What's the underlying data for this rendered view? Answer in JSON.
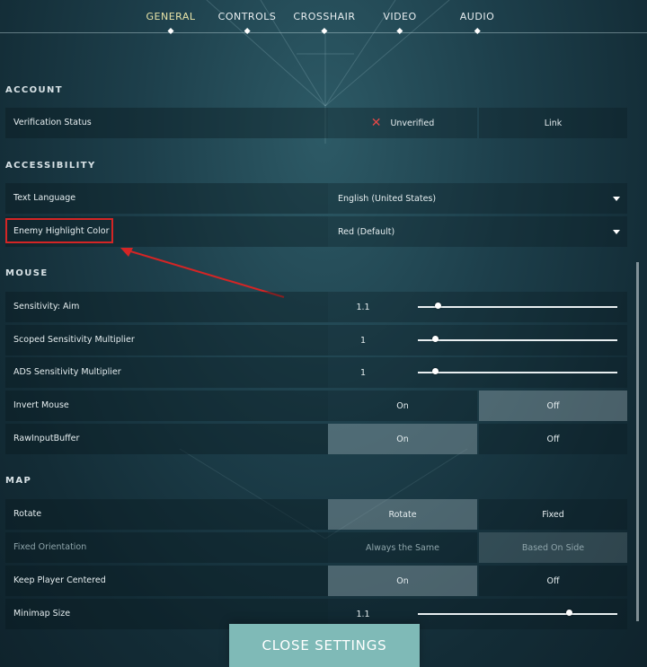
{
  "nav": {
    "tabs": [
      {
        "label": "GENERAL",
        "active": true
      },
      {
        "label": "CONTROLS",
        "active": false
      },
      {
        "label": "CROSSHAIR",
        "active": false
      },
      {
        "label": "VIDEO",
        "active": false
      },
      {
        "label": "AUDIO",
        "active": false
      }
    ]
  },
  "account": {
    "header": "ACCOUNT",
    "verification_label": "Verification Status",
    "status_text": "Unverified",
    "status_icon": "x-icon",
    "link_label": "Link"
  },
  "accessibility": {
    "header": "ACCESSIBILITY",
    "text_language_label": "Text Language",
    "text_language_value": "English (United States)",
    "enemy_highlight_label": "Enemy Highlight Color",
    "enemy_highlight_value": "Red (Default)"
  },
  "mouse": {
    "header": "MOUSE",
    "sensitivity_aim_label": "Sensitivity: Aim",
    "sensitivity_aim_value": "1.1",
    "sensitivity_aim_fraction": 0.1,
    "scoped_label": "Scoped Sensitivity Multiplier",
    "scoped_value": "1",
    "scoped_fraction": 0.09,
    "ads_label": "ADS Sensitivity Multiplier",
    "ads_value": "1",
    "ads_fraction": 0.09,
    "invert_label": "Invert Mouse",
    "invert_on": "On",
    "invert_off": "Off",
    "invert_selected": "off",
    "rawinput_label": "RawInputBuffer",
    "rawinput_on": "On",
    "rawinput_off": "Off",
    "rawinput_selected": "on"
  },
  "map": {
    "header": "MAP",
    "rotate_label": "Rotate",
    "rotate_option_a": "Rotate",
    "rotate_option_b": "Fixed",
    "rotate_selected": "a",
    "fixed_orientation_label": "Fixed Orientation",
    "fixed_orientation_option_a": "Always the Same",
    "fixed_orientation_option_b": "Based On Side",
    "fixed_orientation_selected": "b",
    "keep_centered_label": "Keep Player Centered",
    "keep_centered_on": "On",
    "keep_centered_off": "Off",
    "keep_centered_selected": "on",
    "minimap_size_label": "Minimap Size",
    "minimap_size_value": "1.1",
    "minimap_size_fraction": 0.76
  },
  "footer": {
    "close_label": "CLOSE SETTINGS"
  },
  "colors": {
    "accent": "#7fbab7",
    "annotation": "#d42525",
    "active_tab": "#e8e4a8"
  }
}
